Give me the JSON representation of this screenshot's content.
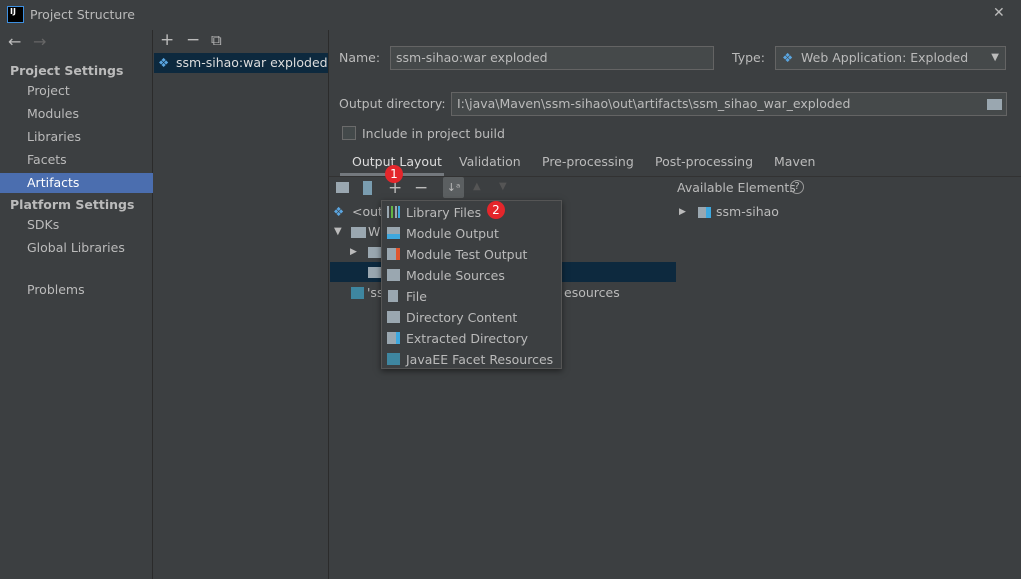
{
  "window": {
    "title": "Project Structure",
    "close": "✕"
  },
  "nav": {
    "back": "←",
    "forward": "→"
  },
  "sidebar": {
    "project_settings": "Project Settings",
    "items": [
      {
        "label": "Project"
      },
      {
        "label": "Modules"
      },
      {
        "label": "Libraries"
      },
      {
        "label": "Facets"
      },
      {
        "label": "Artifacts"
      }
    ],
    "platform_settings": "Platform Settings",
    "platform_items": [
      {
        "label": "SDKs"
      },
      {
        "label": "Global Libraries"
      }
    ],
    "problems": "Problems"
  },
  "artifacts": {
    "add": "+",
    "remove": "−",
    "copy": "⧉",
    "list": [
      "ssm-sihao:war exploded"
    ]
  },
  "form": {
    "name_label": "Name:",
    "name_value": "ssm-sihao:war exploded",
    "type_label": "Type:",
    "type_value": "Web Application: Exploded",
    "output_label": "Output directory:",
    "output_value": "I:\\java\\Maven\\ssm-sihao\\out\\artifacts\\ssm_sihao_war_exploded",
    "include_label": "Include in project build"
  },
  "tabs": [
    "Output Layout",
    "Validation",
    "Pre-processing",
    "Post-processing",
    "Maven"
  ],
  "available": {
    "title": "Available Elements",
    "help": "?",
    "items": [
      "ssm-sihao"
    ]
  },
  "tree": {
    "row0": "<outp",
    "row1": "W",
    "row4a": "'ss",
    "row4b": "esources"
  },
  "menu": {
    "items": [
      "Library Files",
      "Module Output",
      "Module Test Output",
      "Module Sources",
      "File",
      "Directory Content",
      "Extracted Directory",
      "JavaEE Facet Resources"
    ]
  },
  "badges": {
    "one": "1",
    "two": "2"
  },
  "colors": {
    "selection": "#4b6eaf",
    "tree_selection": "#0d293e",
    "badge": "#e4262b"
  }
}
